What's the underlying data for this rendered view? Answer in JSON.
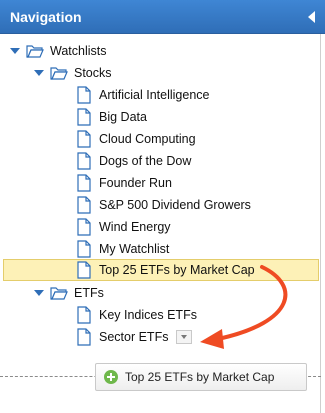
{
  "header": {
    "title": "Navigation"
  },
  "tree": {
    "watchlists": "Watchlists",
    "stocks": "Stocks",
    "stock_items": [
      "Artificial Intelligence",
      "Big Data",
      "Cloud Computing",
      "Dogs of the Dow",
      "Founder Run",
      "S&P 500 Dividend Growers",
      "Wind Energy",
      "My Watchlist",
      "Top 25 ETFs by Market Cap"
    ],
    "etfs": "ETFs",
    "etf_items": [
      "Key Indices ETFs",
      "Sector ETFs"
    ]
  },
  "drag_button": {
    "label": "Top 25 ETFs by Market Cap"
  },
  "colors": {
    "header": "#2f6eb7",
    "selected": "#fdf1b7",
    "arrow": "#ef4b23",
    "plus": "#6fb84b"
  }
}
